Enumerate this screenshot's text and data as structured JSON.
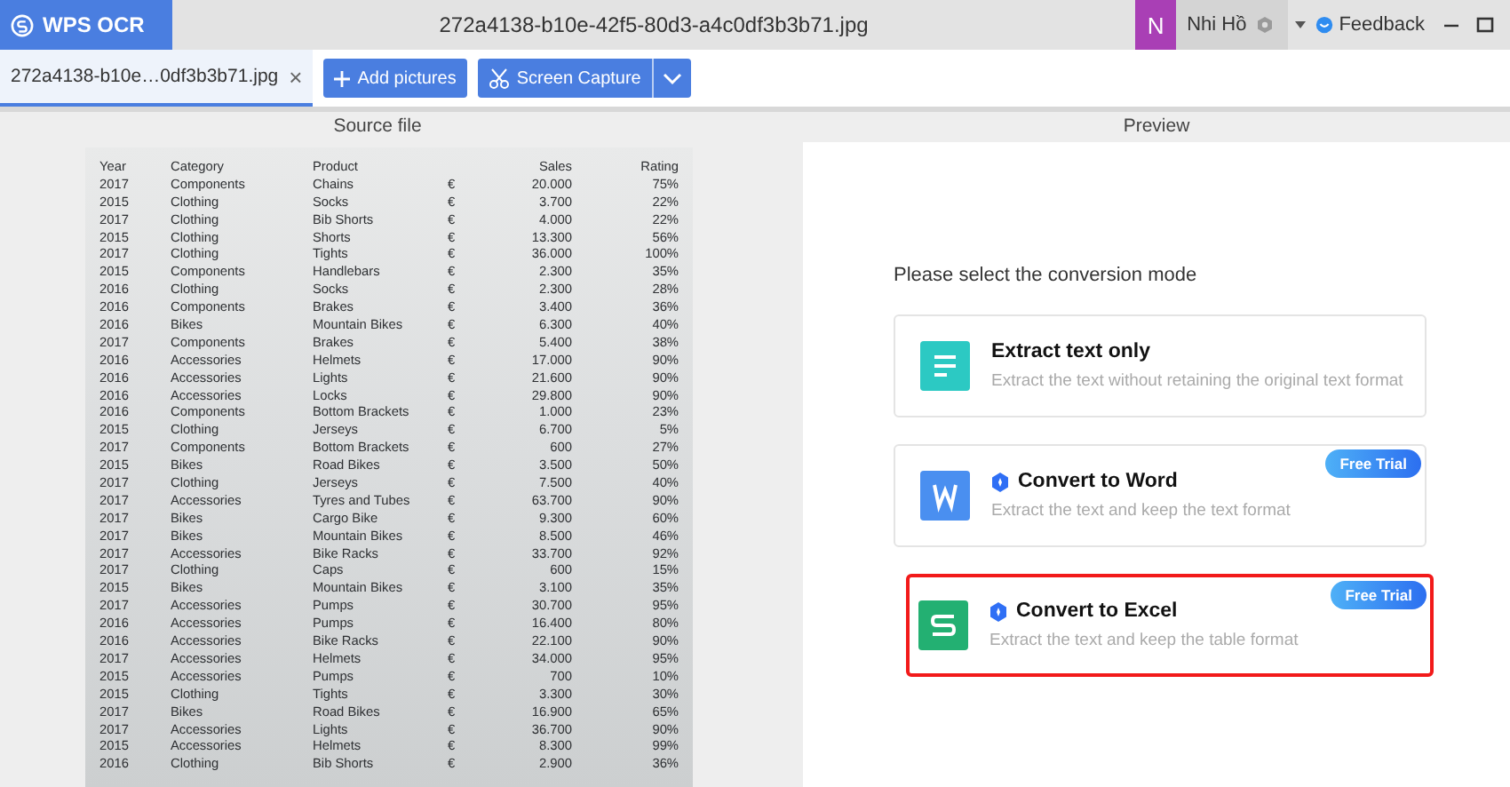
{
  "app": {
    "name": "WPS OCR"
  },
  "window": {
    "title": "272a4138-b10e-42f5-80d3-a4c0df3b3b71.jpg"
  },
  "user": {
    "initial": "N",
    "name": "Nhi Hồ"
  },
  "feedback": "Feedback",
  "file_tab": {
    "label": "272a4138-b10e…0df3b3b71.jpg",
    "close": "×"
  },
  "toolbar": {
    "add": "Add pictures",
    "capture": "Screen Capture"
  },
  "source": {
    "title": "Source file",
    "document": {
      "header": {
        "year": "Year",
        "category": "Category",
        "product": "Product",
        "sales": "Sales",
        "rating": "Rating"
      },
      "rows": [
        {
          "year": "2017",
          "category": "Components",
          "product": "Chains",
          "currency": "€",
          "sales": "20.000",
          "rating": "75%"
        },
        {
          "year": "2015",
          "category": "Clothing",
          "product": "Socks",
          "currency": "€",
          "sales": "3.700",
          "rating": "22%"
        },
        {
          "year": "2017",
          "category": "Clothing",
          "product": "Bib Shorts",
          "currency": "€",
          "sales": "4.000",
          "rating": "22%"
        },
        {
          "year": "2015",
          "category": "Clothing",
          "product": "Shorts",
          "currency": "€",
          "sales": "13.300",
          "rating": "56%"
        },
        {
          "year": "2017",
          "category": "Clothing",
          "product": "Tights",
          "currency": "€",
          "sales": "36.000",
          "rating": "100%"
        },
        {
          "year": "2015",
          "category": "Components",
          "product": "Handlebars",
          "currency": "€",
          "sales": "2.300",
          "rating": "35%"
        },
        {
          "year": "2016",
          "category": "Clothing",
          "product": "Socks",
          "currency": "€",
          "sales": "2.300",
          "rating": "28%"
        },
        {
          "year": "2016",
          "category": "Components",
          "product": "Brakes",
          "currency": "€",
          "sales": "3.400",
          "rating": "36%"
        },
        {
          "year": "2016",
          "category": "Bikes",
          "product": "Mountain Bikes",
          "currency": "€",
          "sales": "6.300",
          "rating": "40%"
        },
        {
          "year": "2017",
          "category": "Components",
          "product": "Brakes",
          "currency": "€",
          "sales": "5.400",
          "rating": "38%"
        },
        {
          "year": "2016",
          "category": "Accessories",
          "product": "Helmets",
          "currency": "€",
          "sales": "17.000",
          "rating": "90%"
        },
        {
          "year": "2016",
          "category": "Accessories",
          "product": "Lights",
          "currency": "€",
          "sales": "21.600",
          "rating": "90%"
        },
        {
          "year": "2016",
          "category": "Accessories",
          "product": "Locks",
          "currency": "€",
          "sales": "29.800",
          "rating": "90%"
        },
        {
          "year": "2016",
          "category": "Components",
          "product": "Bottom Brackets",
          "currency": "€",
          "sales": "1.000",
          "rating": "23%"
        },
        {
          "year": "2015",
          "category": "Clothing",
          "product": "Jerseys",
          "currency": "€",
          "sales": "6.700",
          "rating": "5%"
        },
        {
          "year": "2017",
          "category": "Components",
          "product": "Bottom Brackets",
          "currency": "€",
          "sales": "600",
          "rating": "27%"
        },
        {
          "year": "2015",
          "category": "Bikes",
          "product": "Road Bikes",
          "currency": "€",
          "sales": "3.500",
          "rating": "50%"
        },
        {
          "year": "2017",
          "category": "Clothing",
          "product": "Jerseys",
          "currency": "€",
          "sales": "7.500",
          "rating": "40%"
        },
        {
          "year": "2017",
          "category": "Accessories",
          "product": "Tyres and Tubes",
          "currency": "€",
          "sales": "63.700",
          "rating": "90%"
        },
        {
          "year": "2017",
          "category": "Bikes",
          "product": "Cargo Bike",
          "currency": "€",
          "sales": "9.300",
          "rating": "60%"
        },
        {
          "year": "2017",
          "category": "Bikes",
          "product": "Mountain Bikes",
          "currency": "€",
          "sales": "8.500",
          "rating": "46%"
        },
        {
          "year": "2017",
          "category": "Accessories",
          "product": "Bike Racks",
          "currency": "€",
          "sales": "33.700",
          "rating": "92%"
        },
        {
          "year": "2017",
          "category": "Clothing",
          "product": "Caps",
          "currency": "€",
          "sales": "600",
          "rating": "15%"
        },
        {
          "year": "2015",
          "category": "Bikes",
          "product": "Mountain Bikes",
          "currency": "€",
          "sales": "3.100",
          "rating": "35%"
        },
        {
          "year": "2017",
          "category": "Accessories",
          "product": "Pumps",
          "currency": "€",
          "sales": "30.700",
          "rating": "95%"
        },
        {
          "year": "2016",
          "category": "Accessories",
          "product": "Pumps",
          "currency": "€",
          "sales": "16.400",
          "rating": "80%"
        },
        {
          "year": "2016",
          "category": "Accessories",
          "product": "Bike Racks",
          "currency": "€",
          "sales": "22.100",
          "rating": "90%"
        },
        {
          "year": "2017",
          "category": "Accessories",
          "product": "Helmets",
          "currency": "€",
          "sales": "34.000",
          "rating": "95%"
        },
        {
          "year": "2015",
          "category": "Accessories",
          "product": "Pumps",
          "currency": "€",
          "sales": "700",
          "rating": "10%"
        },
        {
          "year": "2015",
          "category": "Clothing",
          "product": "Tights",
          "currency": "€",
          "sales": "3.300",
          "rating": "30%"
        },
        {
          "year": "2017",
          "category": "Bikes",
          "product": "Road Bikes",
          "currency": "€",
          "sales": "16.900",
          "rating": "65%"
        },
        {
          "year": "2017",
          "category": "Accessories",
          "product": "Lights",
          "currency": "€",
          "sales": "36.700",
          "rating": "90%"
        },
        {
          "year": "2015",
          "category": "Accessories",
          "product": "Helmets",
          "currency": "€",
          "sales": "8.300",
          "rating": "99%"
        },
        {
          "year": "2016",
          "category": "Clothing",
          "product": "Bib Shorts",
          "currency": "€",
          "sales": "2.900",
          "rating": "36%"
        }
      ]
    }
  },
  "preview": {
    "title": "Preview",
    "prompt": "Please select the conversion mode",
    "options": [
      {
        "kind": "text",
        "title": "Extract text only",
        "description": "Extract the text without retaining the original text format",
        "premium": false,
        "selected": false
      },
      {
        "kind": "word",
        "title": "Convert to Word",
        "description": "Extract the text and keep the text format",
        "premium": true,
        "badge": "Free Trial",
        "selected": false
      },
      {
        "kind": "excel",
        "title": "Convert to Excel",
        "description": "Extract the text and keep the table format",
        "premium": true,
        "badge": "Free Trial",
        "selected": true
      }
    ]
  }
}
